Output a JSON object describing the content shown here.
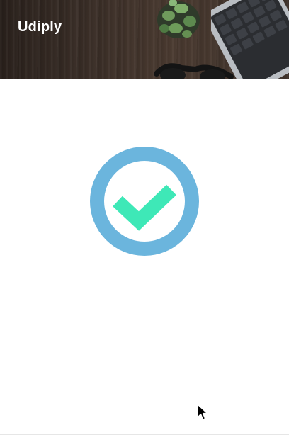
{
  "header": {
    "brand": "Udiply",
    "background_description": "wood-desk-photo"
  },
  "status": {
    "icon": "success-check-icon",
    "ring_color": "#6bb5dd",
    "check_color": "#3ee8b7"
  },
  "colors": {
    "background": "#ffffff",
    "brand_text": "#ffffff"
  }
}
